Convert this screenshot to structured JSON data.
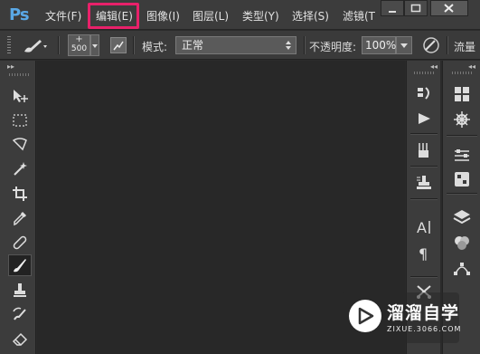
{
  "app": {
    "logo": "Ps"
  },
  "menu": {
    "items": [
      "文件(F)",
      "编辑(E)",
      "图像(I)",
      "图层(L)",
      "类型(Y)",
      "选择(S)",
      "滤镜(T"
    ],
    "highlighted": "编辑(E)",
    "highlight_color": "#e8216a"
  },
  "window_controls": [
    "minimize-icon",
    "maximize-icon",
    "close-icon"
  ],
  "options": {
    "brush_size": "500",
    "brush_size_plus": "+",
    "mode_label": "模式:",
    "mode_value": "正常",
    "opacity_label": "不透明度:",
    "opacity_value": "100%",
    "flow_label": "流量"
  },
  "tools": [
    "move-tool-icon",
    "marquee-tool-icon",
    "lasso-tool-icon",
    "magic-wand-icon",
    "crop-tool-icon",
    "eyedropper-icon",
    "healing-brush-icon",
    "brush-tool-icon",
    "clone-stamp-icon",
    "history-brush-icon",
    "eraser-icon"
  ],
  "active_tool": "brush-tool-icon",
  "panel_icons_left": [
    "histogram-panel-icon",
    "actions-panel-icon",
    "brush-presets-icon",
    "clone-source-icon",
    "character-panel-icon",
    "paragraph-panel-icon",
    "tools-presets-icon"
  ],
  "panel_icons_right": [
    "color-panel-icon",
    "navigator-panel-icon",
    "adjustments-panel-icon",
    "styles-panel-icon",
    "layers-panel-icon",
    "channels-panel-icon",
    "paths-panel-icon"
  ],
  "watermark": {
    "title": "溜溜自学",
    "subtitle": "ZIXUE.3066.COM"
  }
}
